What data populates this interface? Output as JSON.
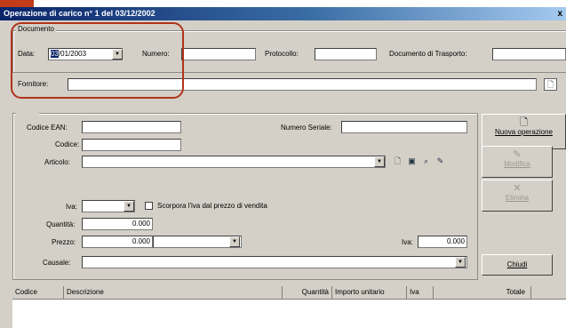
{
  "window": {
    "title": "Operazione di carico n° 1 del 03/12/2002",
    "close_glyph": "x"
  },
  "documento": {
    "group_label": "Documento",
    "data_label": "Data:",
    "data_day": "03",
    "data_rest": "/01/2003",
    "numero_label": "Numero:",
    "numero_value": "",
    "protocollo_label": "Protocollo:",
    "protocollo_value": "",
    "doc_trasporto_label": "Documento di Trasporto:",
    "doc_trasporto_value": "",
    "fornitore_label": "Fornitore:",
    "fornitore_value": ""
  },
  "riga": {
    "codice_ean_label": "Codice EAN:",
    "codice_ean_value": "",
    "numero_seriale_label": "Numero Seriale:",
    "numero_seriale_value": "",
    "codice_label": "Codice:",
    "codice_value": "",
    "articolo_label": "Articolo:",
    "articolo_value": "",
    "iva_label": "Iva:",
    "iva_value": "",
    "scorpora_label": "Scorpora l'iva dal prezzo di vendita",
    "quantita_label": "Quantità:",
    "quantita_value": "0.000",
    "prezzo_label": "Prezzo:",
    "prezzo_value": "0.000",
    "iva2_label": "Iva:",
    "iva2_value": "0.000",
    "causale_label": "Causale:",
    "causale_value": ""
  },
  "side_buttons": {
    "nuova_operazione": "Nuova operazione",
    "modifica": "Modifica",
    "elimina": "Elimina",
    "chiudi": "Chiudi"
  },
  "grid": {
    "columns": [
      "Codice",
      "Descrizione",
      "Quantità",
      "Importo unitario",
      "Iva",
      "Totale"
    ]
  }
}
